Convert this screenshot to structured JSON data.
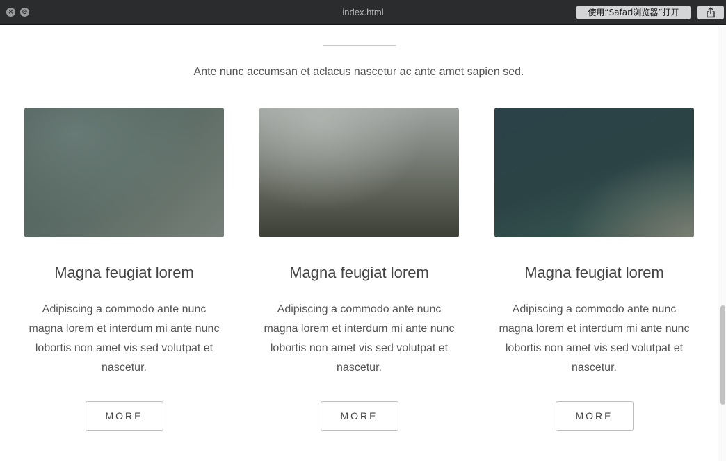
{
  "window": {
    "title": "index.html",
    "open_in_browser": "使用“Safari浏览器”打开"
  },
  "icons": {
    "close": "close-icon",
    "stop": "stop-icon",
    "share": "share-icon"
  },
  "section": {
    "intro": "Ante nunc accumsan et aclacus nascetur ac ante amet sapien sed."
  },
  "cards": [
    {
      "title": "Magna feugiat lorem",
      "text": "Adipiscing a commodo ante nunc magna lorem et interdum mi ante nunc lobortis non amet vis sed volutpat et nascetur.",
      "button": "MORE"
    },
    {
      "title": "Magna feugiat lorem",
      "text": "Adipiscing a commodo ante nunc magna lorem et interdum mi ante nunc lobortis non amet vis sed volutpat et nascetur.",
      "button": "MORE"
    },
    {
      "title": "Magna feugiat lorem",
      "text": "Adipiscing a commodo ante nunc magna lorem et interdum mi ante nunc lobortis non amet vis sed volutpat et nascetur.",
      "button": "MORE"
    }
  ],
  "colors": {
    "titlebar": "#2b2c2e",
    "accent_text": "#555555"
  }
}
